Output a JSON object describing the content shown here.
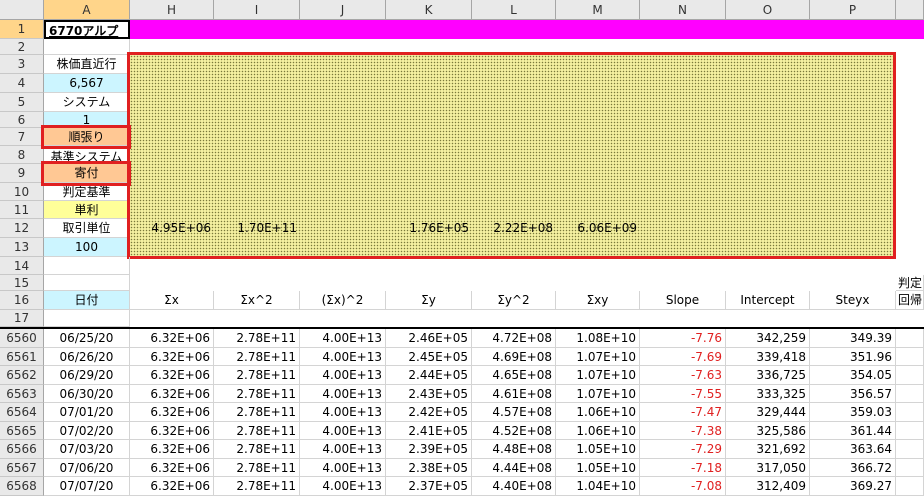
{
  "columns": [
    "A",
    "H",
    "I",
    "J",
    "K",
    "L",
    "M",
    "N",
    "O",
    "P"
  ],
  "column_A": {
    "title": "6770アルプ",
    "r3": "株価直近行",
    "r4": "6,567",
    "r5": "システム",
    "r6": "1",
    "r7": "順張り",
    "r8": "基準システム",
    "r9": "寄付",
    "r10": "判定基準",
    "r11": "単利",
    "r12": "取引単位",
    "r13": "100",
    "r16": "日付"
  },
  "summary_row12": {
    "H": "4.95E+06",
    "I": "1.70E+11",
    "K": "1.76E+05",
    "L": "2.22E+08",
    "M": "6.06E+09"
  },
  "headers_row16": {
    "H": "Σx",
    "I": "Σx^2",
    "J": "(Σx)^2",
    "K": "Σy",
    "L": "Σy^2",
    "M": "Σxy",
    "N": "Slope",
    "O": "Intercept",
    "P": "Steyx",
    "Q15": "判定",
    "Q16": "回帰"
  },
  "rows": [
    {
      "row": "6560",
      "date": "06/25/20",
      "H": "6.32E+06",
      "I": "2.78E+11",
      "J": "4.00E+13",
      "K": "2.46E+05",
      "L": "4.72E+08",
      "M": "1.08E+10",
      "N": "-7.76",
      "O": "342,259",
      "P": "349.39"
    },
    {
      "row": "6561",
      "date": "06/26/20",
      "H": "6.32E+06",
      "I": "2.78E+11",
      "J": "4.00E+13",
      "K": "2.45E+05",
      "L": "4.69E+08",
      "M": "1.07E+10",
      "N": "-7.69",
      "O": "339,418",
      "P": "351.96"
    },
    {
      "row": "6562",
      "date": "06/29/20",
      "H": "6.32E+06",
      "I": "2.78E+11",
      "J": "4.00E+13",
      "K": "2.44E+05",
      "L": "4.65E+08",
      "M": "1.07E+10",
      "N": "-7.63",
      "O": "336,725",
      "P": "354.05"
    },
    {
      "row": "6563",
      "date": "06/30/20",
      "H": "6.32E+06",
      "I": "2.78E+11",
      "J": "4.00E+13",
      "K": "2.43E+05",
      "L": "4.61E+08",
      "M": "1.07E+10",
      "N": "-7.55",
      "O": "333,325",
      "P": "356.57"
    },
    {
      "row": "6564",
      "date": "07/01/20",
      "H": "6.32E+06",
      "I": "2.78E+11",
      "J": "4.00E+13",
      "K": "2.42E+05",
      "L": "4.57E+08",
      "M": "1.06E+10",
      "N": "-7.47",
      "O": "329,444",
      "P": "359.03"
    },
    {
      "row": "6565",
      "date": "07/02/20",
      "H": "6.32E+06",
      "I": "2.78E+11",
      "J": "4.00E+13",
      "K": "2.41E+05",
      "L": "4.52E+08",
      "M": "1.06E+10",
      "N": "-7.38",
      "O": "325,586",
      "P": "361.44"
    },
    {
      "row": "6566",
      "date": "07/03/20",
      "H": "6.32E+06",
      "I": "2.78E+11",
      "J": "4.00E+13",
      "K": "2.39E+05",
      "L": "4.48E+08",
      "M": "1.05E+10",
      "N": "-7.29",
      "O": "321,692",
      "P": "363.64"
    },
    {
      "row": "6567",
      "date": "07/06/20",
      "H": "6.32E+06",
      "I": "2.78E+11",
      "J": "4.00E+13",
      "K": "2.38E+05",
      "L": "4.44E+08",
      "M": "1.05E+10",
      "N": "-7.18",
      "O": "317,050",
      "P": "366.72"
    },
    {
      "row": "6568",
      "date": "07/07/20",
      "H": "6.32E+06",
      "I": "2.78E+11",
      "J": "4.00E+13",
      "K": "2.37E+05",
      "L": "4.40E+08",
      "M": "1.04E+10",
      "N": "-7.08",
      "O": "312,409",
      "P": "369.27"
    }
  ],
  "colors": {
    "magenta": "#ff00ff",
    "highlight_box": "#e02020",
    "cyan": "#ccf5ff",
    "peach": "#ffc894",
    "yellow": "#ffff99",
    "dotted_fill": "#f4f0a0"
  }
}
